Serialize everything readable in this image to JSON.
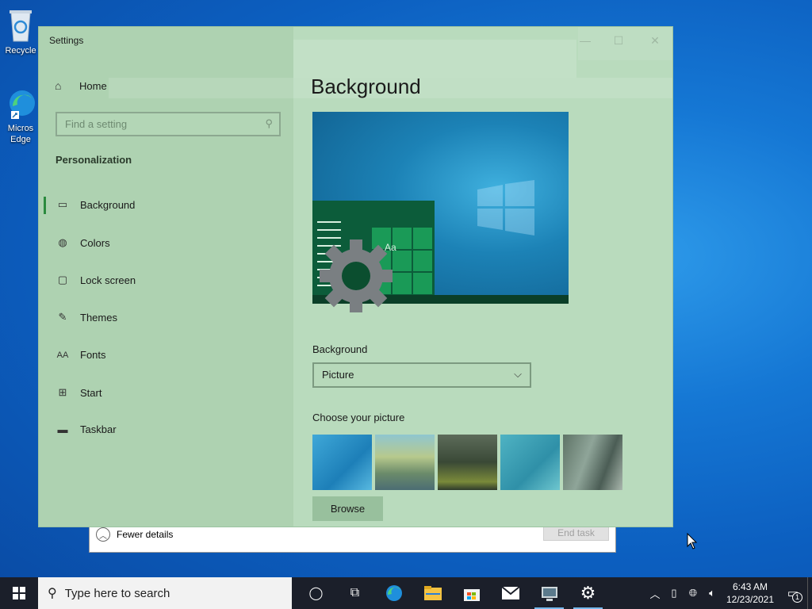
{
  "desktop": {
    "icons": [
      {
        "label": "Recycle",
        "icon": "recycle-bin-icon"
      },
      {
        "label": "Micros Edge",
        "icon": "edge-icon"
      }
    ]
  },
  "task_manager": {
    "fewer_details": "Fewer details",
    "end_task": "End task"
  },
  "settings": {
    "window_title": "Settings",
    "home": "Home",
    "search_placeholder": "Find a setting",
    "section": "Personalization",
    "nav": [
      {
        "label": "Background",
        "icon": "picture-icon",
        "active": true
      },
      {
        "label": "Colors",
        "icon": "palette-icon"
      },
      {
        "label": "Lock screen",
        "icon": "lock-screen-icon"
      },
      {
        "label": "Themes",
        "icon": "themes-icon"
      },
      {
        "label": "Fonts",
        "icon": "fonts-icon"
      },
      {
        "label": "Start",
        "icon": "start-icon"
      },
      {
        "label": "Taskbar",
        "icon": "taskbar-icon"
      }
    ],
    "page_title": "Background",
    "preview_sample_text": "Aa",
    "background_label": "Background",
    "background_value": "Picture",
    "choose_picture_label": "Choose your picture",
    "browse_label": "Browse",
    "accent_color": "#b9dbbd"
  },
  "taskbar": {
    "search_placeholder": "Type here to search",
    "apps": [
      "task-view-icon",
      "edge-icon",
      "file-explorer-icon",
      "store-icon",
      "mail-icon",
      "control-panel-icon",
      "settings-icon"
    ],
    "time": "6:43 AM",
    "date": "12/23/2021",
    "notification_count": "1"
  }
}
